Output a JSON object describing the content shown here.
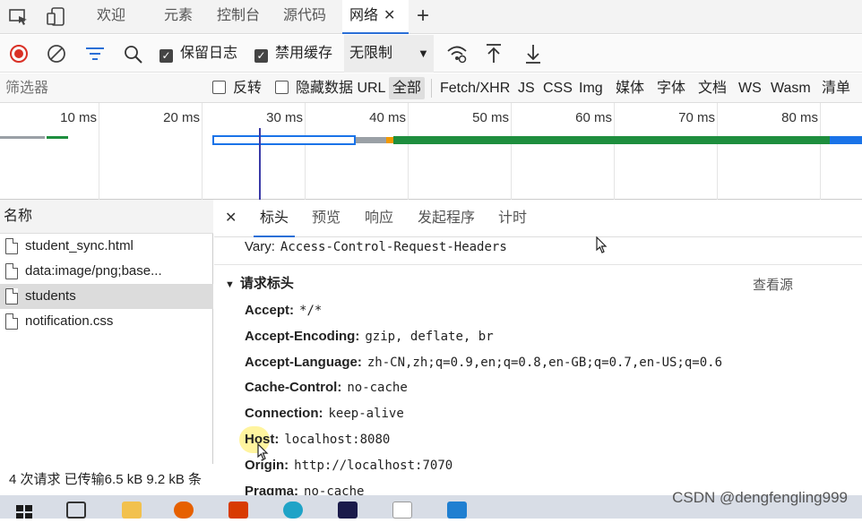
{
  "tabs": {
    "items": [
      "欢迎",
      "元素",
      "控制台",
      "源代码",
      "网络"
    ],
    "active": "网络",
    "add_label": "+",
    "close_label": "✕"
  },
  "toolbar": {
    "preserve_log": "保留日志",
    "disable_cache": "禁用缓存",
    "throttle": "无限制"
  },
  "filterbar": {
    "filter_placeholder": "筛选器",
    "invert": "反转",
    "hide_data_url": "隐藏数据 URL",
    "types": [
      "全部",
      "Fetch/XHR",
      "JS",
      "CSS",
      "Img",
      "媒体",
      "字体",
      "文档",
      "WS",
      "Wasm",
      "清单"
    ],
    "active_type": "全部"
  },
  "timeline": {
    "ticks": [
      "10 ms",
      "20 ms",
      "30 ms",
      "40 ms",
      "50 ms",
      "60 ms",
      "70 ms",
      "80 ms"
    ]
  },
  "requests": {
    "column_header": "名称",
    "items": [
      "student_sync.html",
      "data:image/png;base...",
      "students",
      "notification.css"
    ],
    "selected": "students",
    "summary": "4 次请求  已传输6.5 kB  9.2 kB 条"
  },
  "details": {
    "tabs": [
      "标头",
      "预览",
      "响应",
      "发起程序",
      "计时"
    ],
    "active_tab": "标头",
    "close_label": "✕",
    "vary_key": "Vary:",
    "vary_value": "Access-Control-Request-Headers",
    "section_title": "请求标头",
    "view_source": "查看源",
    "headers": [
      {
        "key": "Accept:",
        "value": "*/*"
      },
      {
        "key": "Accept-Encoding:",
        "value": "gzip, deflate, br"
      },
      {
        "key": "Accept-Language:",
        "value": "zh-CN,zh;q=0.9,en;q=0.8,en-GB;q=0.7,en-US;q=0.6"
      },
      {
        "key": "Cache-Control:",
        "value": "no-cache"
      },
      {
        "key": "Connection:",
        "value": "keep-alive"
      },
      {
        "key": "Host:",
        "value": "localhost:8080"
      },
      {
        "key": "Origin:",
        "value": "http://localhost:7070"
      },
      {
        "key": "Pragma:",
        "value": "no-cache"
      }
    ]
  },
  "watermark": "CSDN @dengfengling999",
  "colors": {
    "accent": "#2a6fd6",
    "record": "#d93025",
    "waterfall_blue": "#1a73e8",
    "waterfall_green": "#1e8e3e",
    "waterfall_gray": "#9aa0a6"
  }
}
